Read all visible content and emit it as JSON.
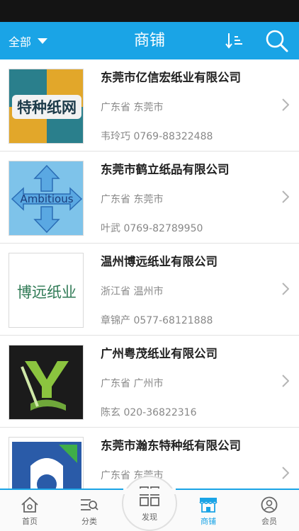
{
  "header": {
    "filter_label": "全部",
    "title": "商铺",
    "accent_color": "#1aa4e6",
    "sort_icon": "sort-icon",
    "search_icon": "search-icon"
  },
  "shops": [
    {
      "name": "东莞市亿信宏纸业有限公司",
      "region": "广东省 东莞市",
      "contact": "韦玲巧 0769-88322488",
      "logo_text": "特种纸网"
    },
    {
      "name": "东莞市鹤立纸品有限公司",
      "region": "广东省 东莞市",
      "contact": "叶武 0769-82789950",
      "logo_text": "Ambitious"
    },
    {
      "name": "温州博远纸业有限公司",
      "region": "浙江省 温州市",
      "contact": "章锦产 0577-68121888",
      "logo_text": "博远纸业"
    },
    {
      "name": "广州粤茂纸业有限公司",
      "region": "广东省 广州市",
      "contact": "陈玄 020-36822316",
      "logo_text": ""
    },
    {
      "name": "东莞市瀚东特种纸有限公司",
      "region": "广东省 东莞市",
      "contact": "",
      "logo_text": ""
    }
  ],
  "tabs": [
    {
      "label": "首页",
      "icon": "home-icon"
    },
    {
      "label": "分类",
      "icon": "category-icon"
    },
    {
      "label": "发现",
      "icon": "grid-icon"
    },
    {
      "label": "商铺",
      "icon": "store-icon",
      "active": true
    },
    {
      "label": "会员",
      "icon": "user-icon"
    }
  ]
}
